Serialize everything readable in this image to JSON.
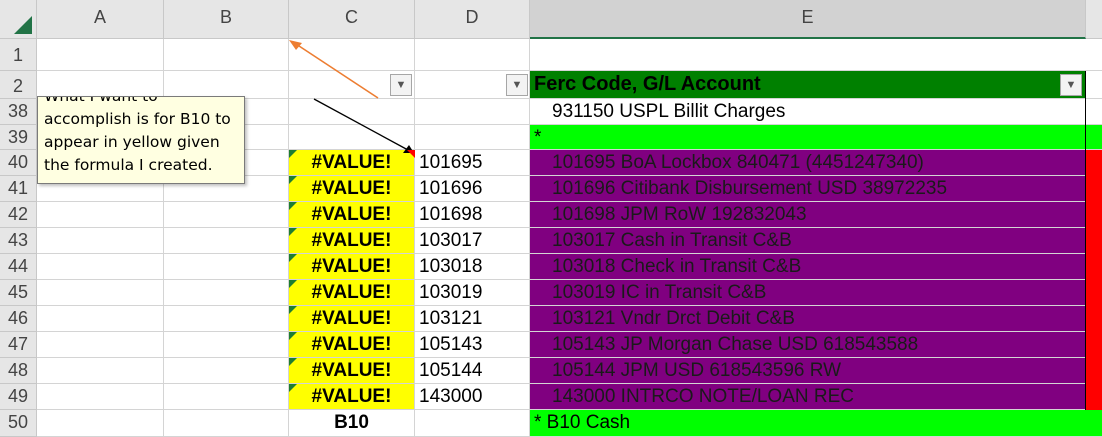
{
  "columns": [
    "A",
    "B",
    "C",
    "D",
    "E"
  ],
  "rows": [
    "1",
    "2",
    "38",
    "39",
    "40",
    "41",
    "42",
    "43",
    "44",
    "45",
    "46",
    "47",
    "48",
    "49",
    "50"
  ],
  "filter_header": "Ferc Code, G/L Account",
  "row38_e": "931150  USPL Billit Charges",
  "row39_e": "*",
  "data_rows": [
    {
      "c": "#VALUE!",
      "d": "101695",
      "e": "101695  BoA Lockbox 840471 (4451247340)"
    },
    {
      "c": "#VALUE!",
      "d": "101696",
      "e": "101696  Citibank Disbursement USD 38972235"
    },
    {
      "c": "#VALUE!",
      "d": "101698",
      "e": "101698  JPM RoW 192832043"
    },
    {
      "c": "#VALUE!",
      "d": "103017",
      "e": "103017  Cash in Transit C&B"
    },
    {
      "c": "#VALUE!",
      "d": "103018",
      "e": "103018  Check in Transit C&B"
    },
    {
      "c": "#VALUE!",
      "d": "103019",
      "e": "103019  IC in Transit C&B"
    },
    {
      "c": "#VALUE!",
      "d": "103121",
      "e": "103121  Vndr Drct Debit C&B"
    },
    {
      "c": "#VALUE!",
      "d": "105143",
      "e": "105143  JP Morgan Chase USD 618543588"
    },
    {
      "c": "#VALUE!",
      "d": "105144",
      "e": "105144  JPM USD 618543596 RW"
    },
    {
      "c": "#VALUE!",
      "d": "143000",
      "e": "143000  INTRCO NOTE/LOAN REC"
    }
  ],
  "row50_c": "B10",
  "row50_e": "*  B10  Cash",
  "comment_lines": [
    "What I want to",
    "accomplish is for B10 to",
    "appear in yellow given",
    "the formula I created."
  ],
  "dropdown_glyph": "▼",
  "colors": {
    "yellow": "#ffff00",
    "purple": "#800080",
    "green": "#00ff00",
    "dark_green": "#008000",
    "red": "#ff0000",
    "selected_header": "#217346"
  }
}
